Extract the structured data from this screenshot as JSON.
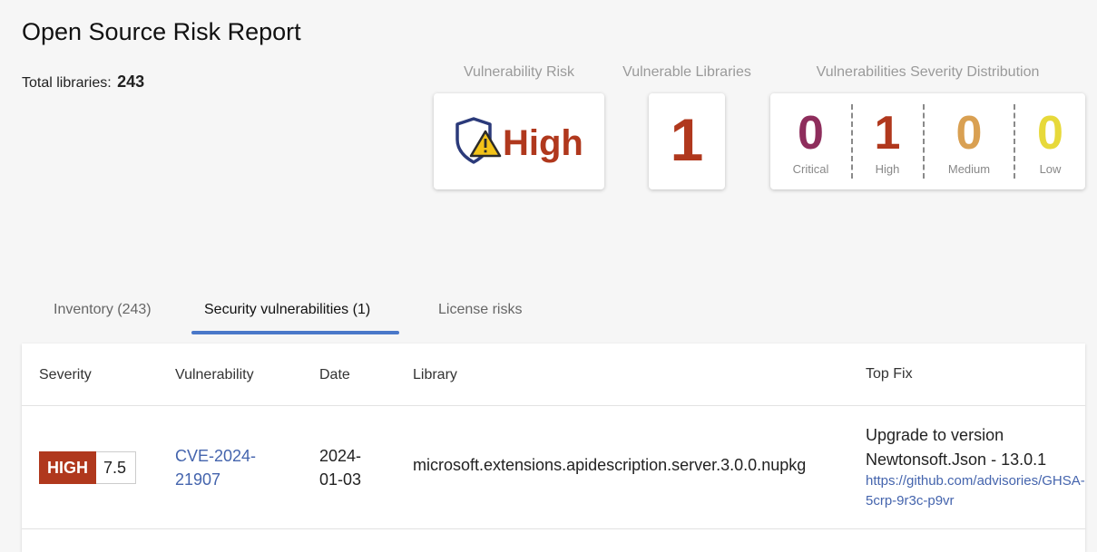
{
  "page": {
    "title": "Open Source Risk Report",
    "total_label": "Total libraries:",
    "total_value": "243"
  },
  "cards": {
    "risk": {
      "label": "Vulnerability Risk",
      "value": "High",
      "icon": "shield-warning-icon",
      "color": "#b0381d"
    },
    "vulnerable": {
      "label": "Vulnerable Libraries",
      "value": "1",
      "color": "#b0381d"
    },
    "distribution": {
      "label": "Vulnerabilities Severity Distribution",
      "items": [
        {
          "count": "0",
          "label": "Critical",
          "color": "#8e2d5c"
        },
        {
          "count": "1",
          "label": "High",
          "color": "#b0381d"
        },
        {
          "count": "0",
          "label": "Medium",
          "color": "#d9a052"
        },
        {
          "count": "0",
          "label": "Low",
          "color": "#e7d93a"
        }
      ]
    }
  },
  "tabs": [
    {
      "label": "Inventory (243)"
    },
    {
      "label": "Security vulnerabilities (1)",
      "active": true
    },
    {
      "label": "License risks"
    }
  ],
  "table": {
    "headers": [
      "Severity",
      "Vulnerability",
      "Date",
      "Library",
      "Top Fix"
    ],
    "rows": [
      {
        "severity": "HIGH",
        "score": "7.5",
        "cve_line1": "CVE-2024-",
        "cve_line2": "21907",
        "date_line1": "2024-",
        "date_line2": "01-03",
        "library": "microsoft.extensions.apidescription.server.3.0.0.nupkg",
        "fix_line1": "Upgrade to version",
        "fix_line2": "Newtonsoft.Json - 13.0.1",
        "fix_url": "https://github.com/advisories/GHSA-5crp-9r3c-p9vr"
      }
    ]
  }
}
